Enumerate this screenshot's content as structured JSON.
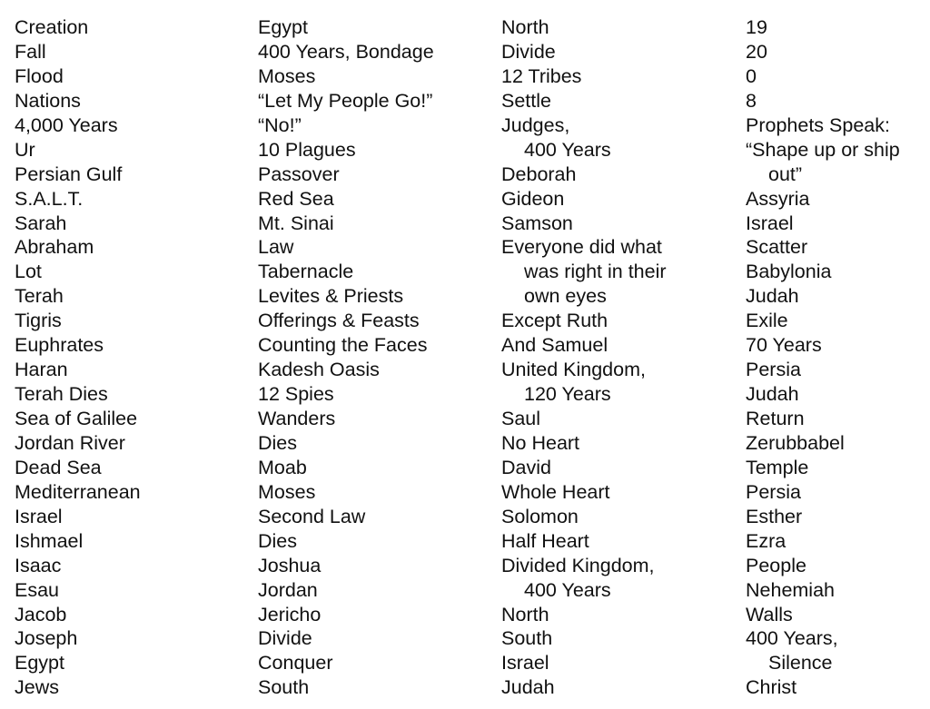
{
  "document": {
    "columns": [
      {
        "items": [
          {
            "text": "Creation",
            "indent": false
          },
          {
            "text": "Fall",
            "indent": false
          },
          {
            "text": "Flood",
            "indent": false
          },
          {
            "text": "Nations",
            "indent": false
          },
          {
            "text": "4,000 Years",
            "indent": false
          },
          {
            "text": "Ur",
            "indent": false
          },
          {
            "text": "Persian Gulf",
            "indent": false
          },
          {
            "text": "S.A.L.T.",
            "indent": false
          },
          {
            "text": "Sarah",
            "indent": false
          },
          {
            "text": "Abraham",
            "indent": false
          },
          {
            "text": "Lot",
            "indent": false
          },
          {
            "text": "Terah",
            "indent": false
          },
          {
            "text": "Tigris",
            "indent": false
          },
          {
            "text": "Euphrates",
            "indent": false
          },
          {
            "text": "Haran",
            "indent": false
          },
          {
            "text": "Terah Dies",
            "indent": false
          },
          {
            "text": "Sea of Galilee",
            "indent": false
          },
          {
            "text": "Jordan River",
            "indent": false
          },
          {
            "text": "Dead Sea",
            "indent": false
          },
          {
            "text": "Mediterranean",
            "indent": false
          },
          {
            "text": "Israel",
            "indent": false
          },
          {
            "text": "Ishmael",
            "indent": false
          },
          {
            "text": "Isaac",
            "indent": false
          },
          {
            "text": "Esau",
            "indent": false
          },
          {
            "text": "Jacob",
            "indent": false
          },
          {
            "text": "Joseph",
            "indent": false
          },
          {
            "text": "Egypt",
            "indent": false
          },
          {
            "text": "Jews",
            "indent": false
          }
        ]
      },
      {
        "items": [
          {
            "text": "Egypt",
            "indent": false
          },
          {
            "text": "400 Years, Bondage",
            "indent": false
          },
          {
            "text": "Moses",
            "indent": false
          },
          {
            "text": "“Let My People Go!”",
            "indent": false
          },
          {
            "text": "“No!”",
            "indent": false
          },
          {
            "text": "10 Plagues",
            "indent": false
          },
          {
            "text": "Passover",
            "indent": false
          },
          {
            "text": "Red Sea",
            "indent": false
          },
          {
            "text": "Mt. Sinai",
            "indent": false
          },
          {
            "text": "Law",
            "indent": false
          },
          {
            "text": "Tabernacle",
            "indent": false
          },
          {
            "text": "Levites & Priests",
            "indent": false
          },
          {
            "text": "Offerings & Feasts",
            "indent": false
          },
          {
            "text": "Counting the Faces",
            "indent": false
          },
          {
            "text": "Kadesh Oasis",
            "indent": false
          },
          {
            "text": "12 Spies",
            "indent": false
          },
          {
            "text": "Wanders",
            "indent": false
          },
          {
            "text": "Dies",
            "indent": false
          },
          {
            "text": "Moab",
            "indent": false
          },
          {
            "text": "Moses",
            "indent": false
          },
          {
            "text": "Second Law",
            "indent": false
          },
          {
            "text": "Dies",
            "indent": false
          },
          {
            "text": "Joshua",
            "indent": false
          },
          {
            "text": "Jordan",
            "indent": false
          },
          {
            "text": "Jericho",
            "indent": false
          },
          {
            "text": "Divide",
            "indent": false
          },
          {
            "text": "Conquer",
            "indent": false
          },
          {
            "text": "South",
            "indent": false
          }
        ]
      },
      {
        "items": [
          {
            "text": "North",
            "indent": false
          },
          {
            "text": "Divide",
            "indent": false
          },
          {
            "text": "12 Tribes",
            "indent": false
          },
          {
            "text": "Settle",
            "indent": false
          },
          {
            "text": "Judges,",
            "indent": false
          },
          {
            "text": "400 Years",
            "indent": true
          },
          {
            "text": "Deborah",
            "indent": false
          },
          {
            "text": "Gideon",
            "indent": false
          },
          {
            "text": "Samson",
            "indent": false
          },
          {
            "text": "Everyone did what",
            "indent": false
          },
          {
            "text": "was right in their",
            "indent": true
          },
          {
            "text": "own eyes",
            "indent": true
          },
          {
            "text": "Except Ruth",
            "indent": false
          },
          {
            "text": "And Samuel",
            "indent": false
          },
          {
            "text": "United Kingdom,",
            "indent": false
          },
          {
            "text": "120 Years",
            "indent": true
          },
          {
            "text": "Saul",
            "indent": false
          },
          {
            "text": "No Heart",
            "indent": false
          },
          {
            "text": "David",
            "indent": false
          },
          {
            "text": "Whole Heart",
            "indent": false
          },
          {
            "text": "Solomon",
            "indent": false
          },
          {
            "text": "Half Heart",
            "indent": false
          },
          {
            "text": "Divided Kingdom,",
            "indent": false
          },
          {
            "text": "400 Years",
            "indent": true
          },
          {
            "text": "North",
            "indent": false
          },
          {
            "text": "South",
            "indent": false
          },
          {
            "text": "Israel",
            "indent": false
          },
          {
            "text": "Judah",
            "indent": false
          }
        ]
      },
      {
        "items": [
          {
            "text": "19",
            "indent": false
          },
          {
            "text": "20",
            "indent": false
          },
          {
            "text": "0",
            "indent": false
          },
          {
            "text": "8",
            "indent": false
          },
          {
            "text": "Prophets Speak:",
            "indent": false
          },
          {
            "text": "“Shape up or ship",
            "indent": false
          },
          {
            "text": "out”",
            "indent": true
          },
          {
            "text": "Assyria",
            "indent": false
          },
          {
            "text": "Israel",
            "indent": false
          },
          {
            "text": "Scatter",
            "indent": false
          },
          {
            "text": "Babylonia",
            "indent": false
          },
          {
            "text": "Judah",
            "indent": false
          },
          {
            "text": "Exile",
            "indent": false
          },
          {
            "text": "70 Years",
            "indent": false
          },
          {
            "text": "Persia",
            "indent": false
          },
          {
            "text": "Judah",
            "indent": false
          },
          {
            "text": "Return",
            "indent": false
          },
          {
            "text": "Zerubbabel",
            "indent": false
          },
          {
            "text": "Temple",
            "indent": false
          },
          {
            "text": "Persia",
            "indent": false
          },
          {
            "text": "Esther",
            "indent": false
          },
          {
            "text": "Ezra",
            "indent": false
          },
          {
            "text": "People",
            "indent": false
          },
          {
            "text": "Nehemiah",
            "indent": false
          },
          {
            "text": "Walls",
            "indent": false
          },
          {
            "text": "400 Years,",
            "indent": false
          },
          {
            "text": "Silence",
            "indent": true
          },
          {
            "text": "Christ",
            "indent": false
          }
        ]
      }
    ]
  }
}
